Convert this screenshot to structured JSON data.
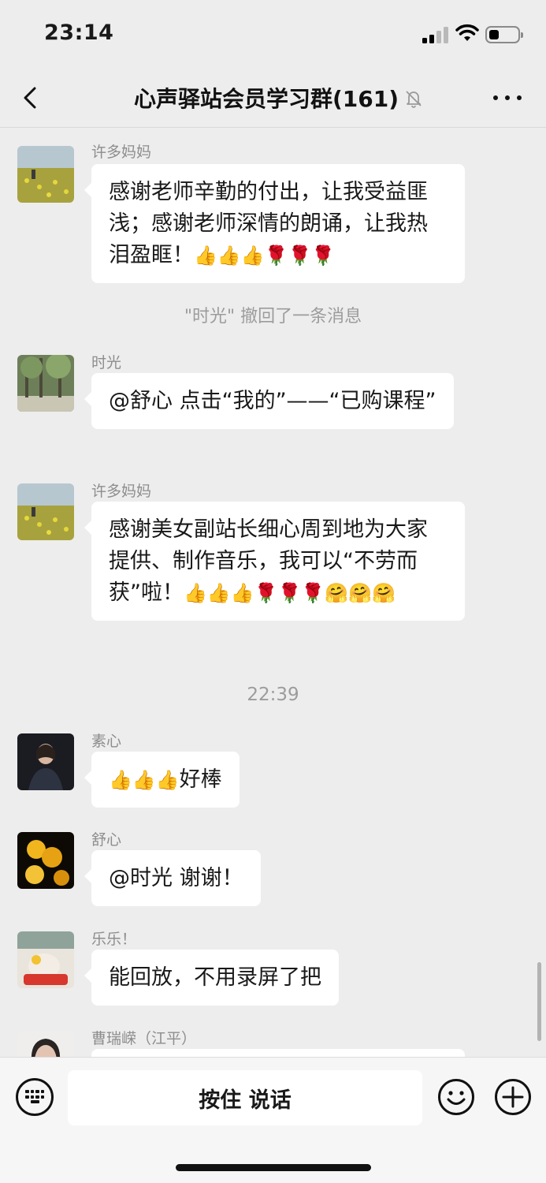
{
  "status_bar": {
    "time": "23:14",
    "battery_level": 0.35
  },
  "nav": {
    "title": "心声驿站会员学习群(161)",
    "back_icon": "chevron-left-icon",
    "mute_icon": "bell-slash-icon",
    "more_icon": "ellipsis-icon"
  },
  "messages": [
    {
      "sender": "许多妈妈",
      "text": "感谢老师辛勤的付出，让我受益匪浅；感谢老师深情的朗诵，让我热泪盈眶！",
      "emoji": "👍👍👍🌹🌹🌹"
    },
    {
      "system": "\"时光\" 撤回了一条消息"
    },
    {
      "sender": "时光",
      "text": "@舒心 点击“我的”——“已购课程”"
    },
    {
      "sender": "许多妈妈",
      "text": "感谢美女副站长细心周到地为大家提供、制作音乐，我可以“不劳而获”啦！",
      "emoji": "👍👍👍🌹🌹🌹🤗🤗🤗"
    },
    {
      "timestamp": "22:39"
    },
    {
      "sender": "素心",
      "emoji": "👍👍👍",
      "text": "好棒"
    },
    {
      "sender": "舒心",
      "text": "@时光 谢谢！"
    },
    {
      "sender": "乐乐！",
      "text": "能回放，不用录屏了把"
    },
    {
      "sender": "曹瑞嵘（江平）"
    }
  ],
  "input_bar": {
    "voice_label": "按住 说话",
    "keyboard_icon": "keyboard-icon",
    "emoji_icon": "smiley-icon",
    "plus_icon": "plus-circle-icon"
  }
}
